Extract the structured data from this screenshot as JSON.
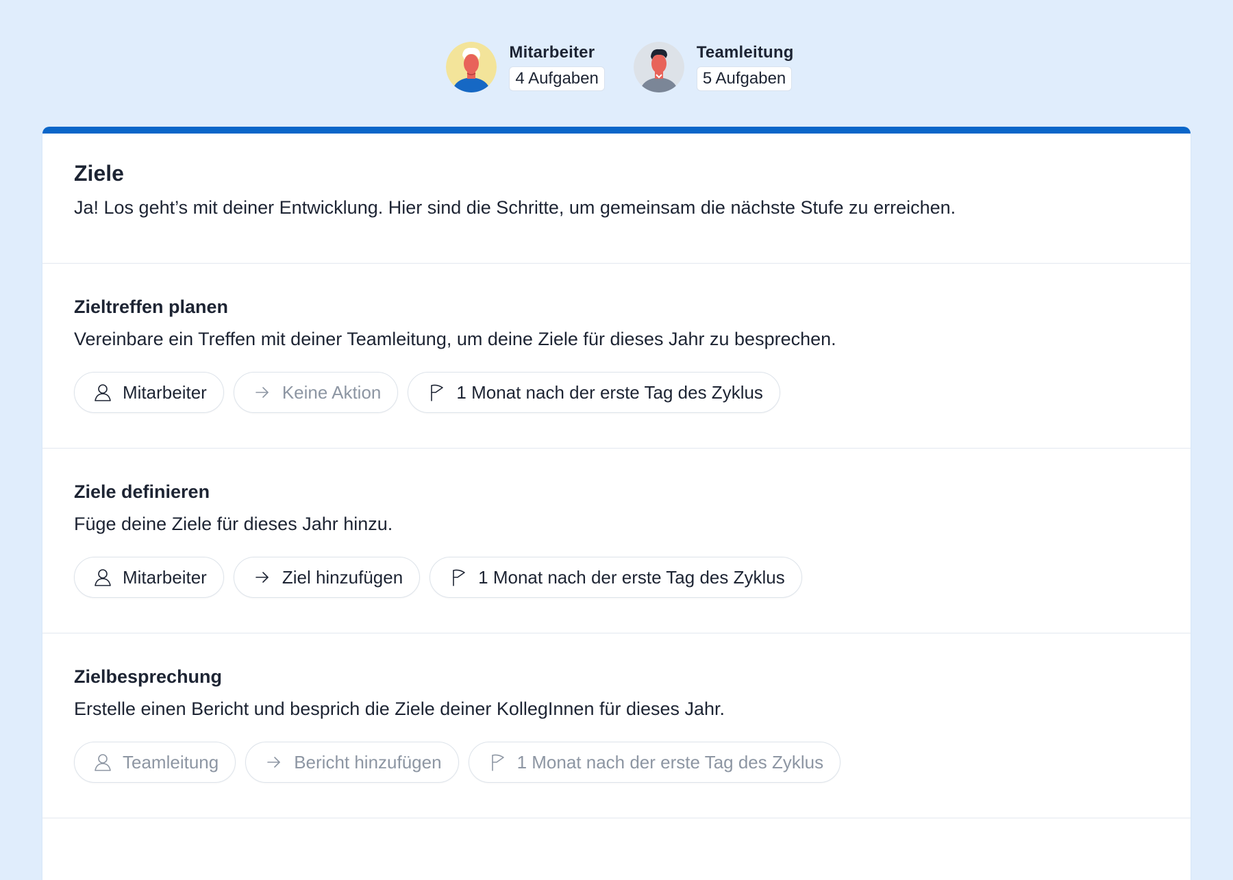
{
  "roles": [
    {
      "name": "Mitarbeiter",
      "tasks": "4 Aufgaben",
      "avatar_icon": "employee-avatar",
      "avatar_bg": "#f3e49a"
    },
    {
      "name": "Teamleitung",
      "tasks": "5 Aufgaben",
      "avatar_icon": "team-lead-avatar",
      "avatar_bg": "#dde2e8"
    }
  ],
  "colors": {
    "accent": "#0a66c9",
    "muted_text": "#8d96a3",
    "background": "#e0edfc"
  },
  "intro": {
    "title": "Ziele",
    "text": "Ja! Los geht’s mit deiner Entwicklung. Hier sind die Schritte, um gemeinsam die nächste Stufe zu erreichen."
  },
  "steps": [
    {
      "title": "Zieltreffen planen",
      "description": "Vereinbare ein Treffen mit deiner Teamleitung, um deine Ziele für dieses Jahr zu besprechen.",
      "assignee": "Mitarbeiter",
      "action": "Keine Aktion",
      "due": "1 Monat nach der erste Tag des Zyklus"
    },
    {
      "title": "Ziele definieren",
      "description": "Füge deine Ziele für dieses Jahr hinzu.",
      "assignee": "Mitarbeiter",
      "action": "Ziel hinzufügen",
      "due": "1 Monat nach der erste Tag des Zyklus"
    },
    {
      "title": "Zielbesprechung",
      "description": "Erstelle einen Bericht und besprich die Ziele deiner KollegInnen für dieses Jahr.",
      "assignee": "Teamleitung",
      "action": "Bericht hinzufügen",
      "due": "1 Monat nach der erste Tag des Zyklus"
    }
  ]
}
